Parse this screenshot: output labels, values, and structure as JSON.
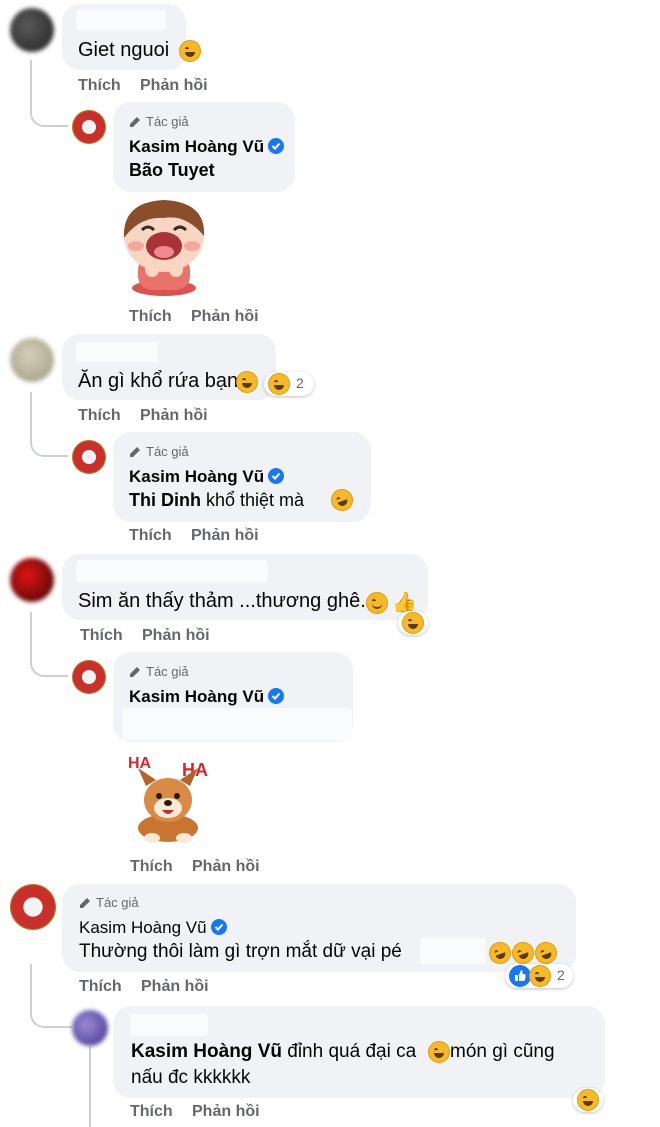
{
  "actions": {
    "like": "Thích",
    "reply": "Phản hồi"
  },
  "author_badge": "Tác giả",
  "author_name": "Kasim Hoàng Vũ",
  "colors": {
    "bubble": "#f0f2f5",
    "action": "#65676b",
    "verified": "#1877f2",
    "emoji": "#f7b928",
    "thread_line": "#ccd0d5"
  },
  "comments": [
    {
      "text": "Giet nguoi",
      "reaction_icon": "laugh-emoji-icon"
    },
    {
      "text": "Ăn gì khổ rứa bạn",
      "reaction_count": "2"
    },
    {
      "text": "Sim ăn thấy thảm ...thương ghê.."
    },
    {
      "text": "Thường thôi làm gì trợn mắt dữ vại pé",
      "reaction_count": "2"
    },
    {
      "mention": "Kasim Hoàng Vũ",
      "text_line1": " đỉnh quá đại ca ",
      "text_line1b": " món gì cũng",
      "text_line2": "nấu đc kkkkkk"
    }
  ],
  "replies": [
    {
      "mention": "Bão Tuyet",
      "sticker": "laughing-girl-sticker"
    },
    {
      "mention": "Thi Dinh",
      "text": " khổ thiệt mà "
    },
    {
      "sticker": "haha-dog-sticker",
      "sticker_text": "HA HA"
    }
  ]
}
